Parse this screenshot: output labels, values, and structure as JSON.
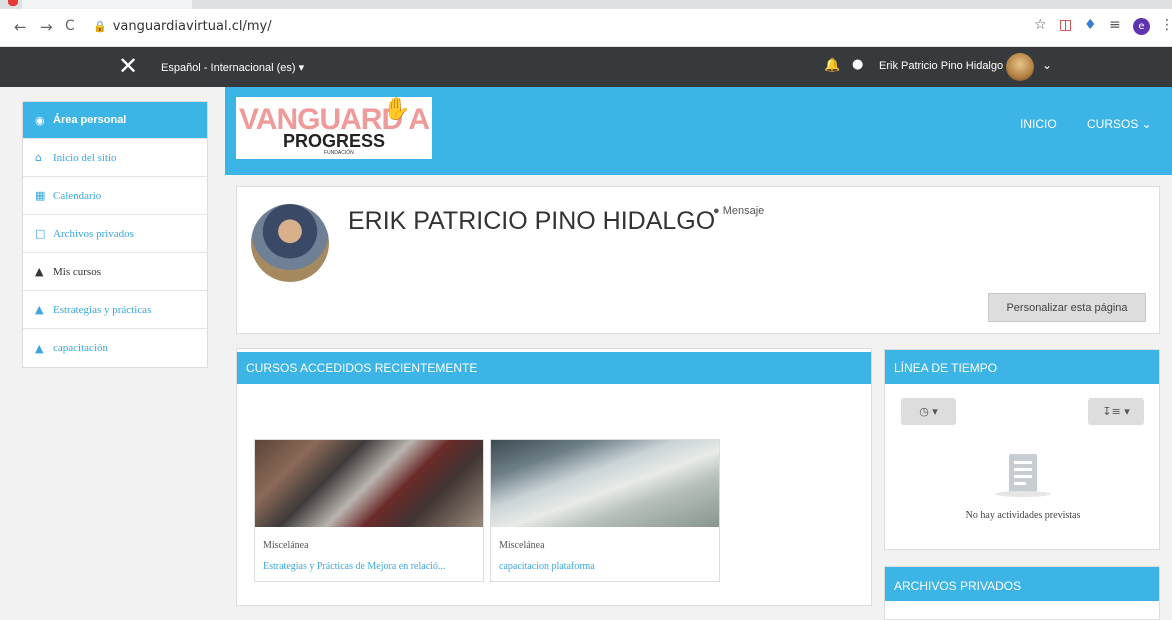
{
  "browser": {
    "url": "vanguardiavirtual.cl/my/",
    "back_icon": "←",
    "forward_icon": "→",
    "reload_icon": "C"
  },
  "topbar": {
    "close_glyph": "✕",
    "language": "Español - Internacional (es) ▾",
    "user_name": "Erik Patricio Pino Hidalgo"
  },
  "sidebar": {
    "items": [
      {
        "label": "Área personal",
        "icon": "dashboard-icon"
      },
      {
        "label": "Inicio del sitio",
        "icon": "home-icon"
      },
      {
        "label": "Calendario",
        "icon": "calendar-icon"
      },
      {
        "label": "Archivos privados",
        "icon": "file-icon"
      },
      {
        "label": "Mis cursos",
        "icon": "graduation-cap-icon"
      },
      {
        "label": "Estrategias y prácticas",
        "icon": "graduation-cap-icon"
      },
      {
        "label": "capacitación",
        "icon": "graduation-cap-icon"
      }
    ]
  },
  "banner": {
    "logo_line1": "VANGUARD A",
    "logo_line2": "PROGRESS",
    "logo_line3": "FUNDACIÓN",
    "nav_home": "INICIO",
    "nav_courses": "CURSOS ⌄"
  },
  "profile": {
    "name": "ERIK PATRICIO PINO HIDALGO",
    "message_label": "Mensaje",
    "customize_button": "Personalizar esta página"
  },
  "recent_courses": {
    "header": "CURSOS ACCEDIDOS RECIENTEMENTE",
    "courses": [
      {
        "category": "Miscelánea",
        "title": "Estrategias y Prácticas de Mejora en relació..."
      },
      {
        "category": "Miscelánea",
        "title": "capacitacion plataforma"
      }
    ]
  },
  "timeline": {
    "header": "LÍNEA DE TIEMPO",
    "filter_button": "◷ ▾",
    "sort_button": "↧≡ ▾",
    "empty_text": "No hay actividades previstas"
  },
  "private_files": {
    "header": "ARCHIVOS PRIVADOS"
  },
  "colors": {
    "accent": "#3cb4e5",
    "navbar": "#373a3c",
    "link": "#3aa6dd"
  }
}
